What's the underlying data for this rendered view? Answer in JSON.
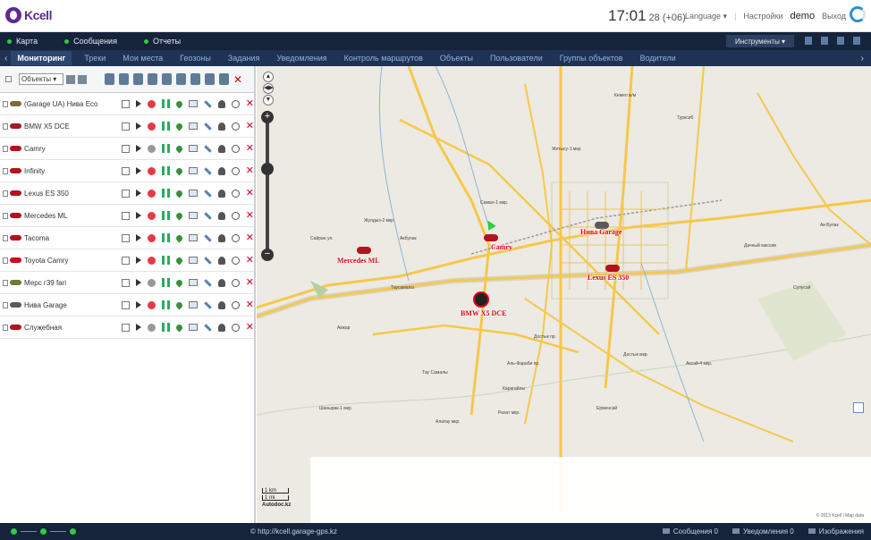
{
  "header": {
    "logo": "Kcell",
    "time": "17:01",
    "seconds_tz": "28 (+06)",
    "language": "Language ▾",
    "settings": "Настройки",
    "user": "demo",
    "logout": "Выход"
  },
  "nav1": {
    "items": [
      "Карта",
      "Сообщения",
      "Отчеты"
    ],
    "tools": "Инструменты ▾"
  },
  "nav2": {
    "tabs": [
      "Мониторинг",
      "Треки",
      "Мои места",
      "Геозоны",
      "Задания",
      "Уведомления",
      "Контроль маршрутов",
      "Объекты",
      "Пользователи",
      "Группы объектов",
      "Водители"
    ]
  },
  "panel": {
    "select_value": "Объекты ▾",
    "units": [
      {
        "name": "(Garage UA) Нива Eco",
        "color": "#7a6b3a",
        "stop": "#e63946"
      },
      {
        "name": "BMW X5 DCE",
        "color": "#a01c24",
        "stop": "#e63946"
      },
      {
        "name": "Camry",
        "color": "#b3121e",
        "stop": "#999999"
      },
      {
        "name": "Infinity",
        "color": "#b3121e",
        "stop": "#e63946"
      },
      {
        "name": "Lexus ES 350",
        "color": "#b3121e",
        "stop": "#e63946"
      },
      {
        "name": "Mercedes ML",
        "color": "#b3121e",
        "stop": "#e63946"
      },
      {
        "name": "Tacoma",
        "color": "#b3121e",
        "stop": "#e63946"
      },
      {
        "name": "Toyota Camry",
        "color": "#d0021b",
        "stop": "#e63946"
      },
      {
        "name": "Мерс г39 fari",
        "color": "#6b7d3a",
        "stop": "#999999"
      },
      {
        "name": "Нива Garage",
        "color": "#5a5a5a",
        "stop": "#e63946"
      },
      {
        "name": "Служебная",
        "color": "#b3121e",
        "stop": "#999999"
      }
    ]
  },
  "map": {
    "vehicles": [
      "Mercedes ML",
      "Camry",
      "Нива Garage",
      "Lexus ES 350",
      "BMW X5 DCE"
    ],
    "places": [
      "Жулдыз-2 мкр.",
      "Самал-1 мкр.",
      "Сайран ул.",
      "Акбулак",
      "Таусамалы",
      "Кемел ж/м",
      "Турксиб",
      "Жетысу-1 мкр.",
      "Достык пр.",
      "Аль-Фараби пр.",
      "Акжар",
      "Шанырак-1 мкр.",
      "Рахат мкр.",
      "Алатау мкр.",
      "Ерменсай",
      "Карагайлы",
      "Дачный массив",
      "Ак-Булак",
      "Сулусай",
      "Аксай-4 мкр.",
      "Достык мкр.",
      "Тау Самалы"
    ],
    "scale_km": "1 km",
    "scale_mi": "1 mi",
    "scale_brand": "Autodoc.kz",
    "copyright": "© 2013 Kcell | Map data"
  },
  "footer": {
    "url": "© http://kcell.garage-gps.kz",
    "messages": "Сообщения",
    "messages_count": "0",
    "notifications": "Уведомления",
    "notifications_count": "0",
    "images": "Изображения"
  }
}
